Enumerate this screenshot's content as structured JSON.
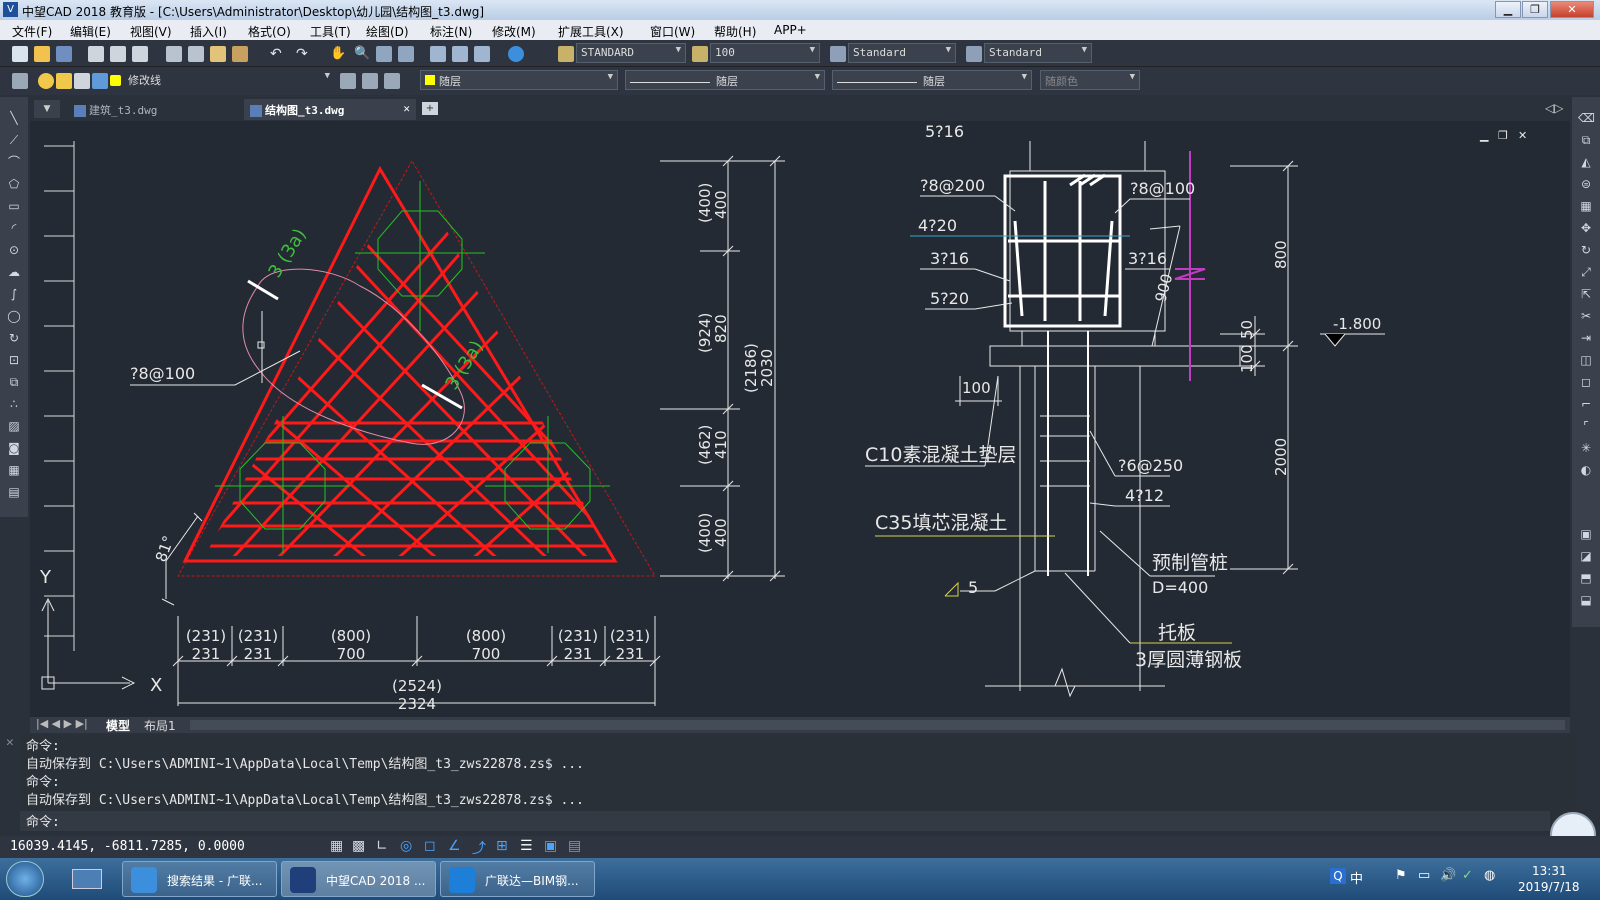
{
  "window": {
    "title": "中望CAD 2018 教育版 - [C:\\Users\\Administrator\\Desktop\\幼儿园\\结构图_t3.dwg]"
  },
  "menu": [
    "文件(F)",
    "编辑(E)",
    "视图(V)",
    "插入(I)",
    "格式(O)",
    "工具(T)",
    "绘图(D)",
    "标注(N)",
    "修改(M)",
    "扩展工具(X)",
    "窗口(W)",
    "帮助(H)",
    "APP+"
  ],
  "toolbar": {
    "text_style": "STANDARD",
    "scale": "100",
    "dim_style": "Standard",
    "table_style": "Standard",
    "layer": "修改线",
    "color": "随层",
    "linetype": "随层",
    "lineweight": "随层",
    "plotstyle": "随颜色"
  },
  "tabs": [
    {
      "label": "建筑_t3.dwg",
      "active": false
    },
    {
      "label": "结构图_t3.dwg",
      "active": true
    }
  ],
  "layout_tabs": [
    "模型",
    "布局1"
  ],
  "drawing": {
    "left": {
      "label_3_3a": "3 (3a)",
      "rebar_left": "?8@100",
      "angle": "81°",
      "dims_vertical": [
        {
          "top": "(400)",
          "bottom": "400"
        },
        {
          "top": "(924)",
          "bottom": "820"
        },
        {
          "top": "(462)",
          "bottom": "410"
        },
        {
          "top": "(400)",
          "bottom": "400"
        }
      ],
      "dim_total_vertical": {
        "top": "(2186)",
        "bottom": "2030"
      },
      "dims_horizontal": [
        {
          "top": "(231)",
          "bottom": "231"
        },
        {
          "top": "(231)",
          "bottom": "231"
        },
        {
          "top": "(800)",
          "bottom": "700"
        },
        {
          "top": "(800)",
          "bottom": "700"
        },
        {
          "top": "(231)",
          "bottom": "231"
        },
        {
          "top": "(231)",
          "bottom": "231"
        }
      ],
      "dim_total_horizontal": {
        "top": "(2524)",
        "bottom": "2324"
      },
      "ucs_x": "X",
      "ucs_y": "Y"
    },
    "right": {
      "top_rebar": "5?16",
      "stirrup_left": "?8@200",
      "stirrup_right": "?8@100",
      "side_rebar": "4?20",
      "mid_rebar_left": "3?16",
      "mid_rebar_right": "3?16",
      "bottom_rebar": "5?20",
      "dim_900": "900",
      "dim_800": "800",
      "dim_50": "50",
      "dim_100_right": "100",
      "elevation": "-1.800",
      "dim_100_left": "100",
      "cushion": "C10素混凝土垫层",
      "pile_stirrup": "?6@250",
      "pile_rebar": "4?12",
      "fill_concrete": "C35填芯混凝土",
      "pile_name": "预制管桩",
      "pile_d": "D=400",
      "dim_2000": "2000",
      "weld": "5",
      "tray": "托板",
      "plate": "3厚圆薄钢板"
    }
  },
  "command": {
    "lines": [
      "命令:",
      "自动保存到 C:\\Users\\ADMINI~1\\AppData\\Local\\Temp\\结构图_t3_zws22878.zs$ ...",
      "命令:",
      "自动保存到 C:\\Users\\ADMINI~1\\AppData\\Local\\Temp\\结构图_t3_zws22878.zs$ ..."
    ],
    "prompt": "命令:"
  },
  "status": {
    "coords": "16039.4145, -6811.7285, 0.0000"
  },
  "taskbar": {
    "items": [
      "搜索结果 - 广联...",
      "中望CAD 2018 ...",
      "广联达—BIM钢..."
    ],
    "time": "13:31",
    "date": "2019/7/18",
    "ime": "中"
  },
  "colors": {
    "rebar": "#ff1a1a",
    "pile": "#22c222",
    "canvas": "#242a33",
    "dim": "#e8e8e8",
    "leader": "#d2d250",
    "section_mark": "#c03cc0"
  }
}
